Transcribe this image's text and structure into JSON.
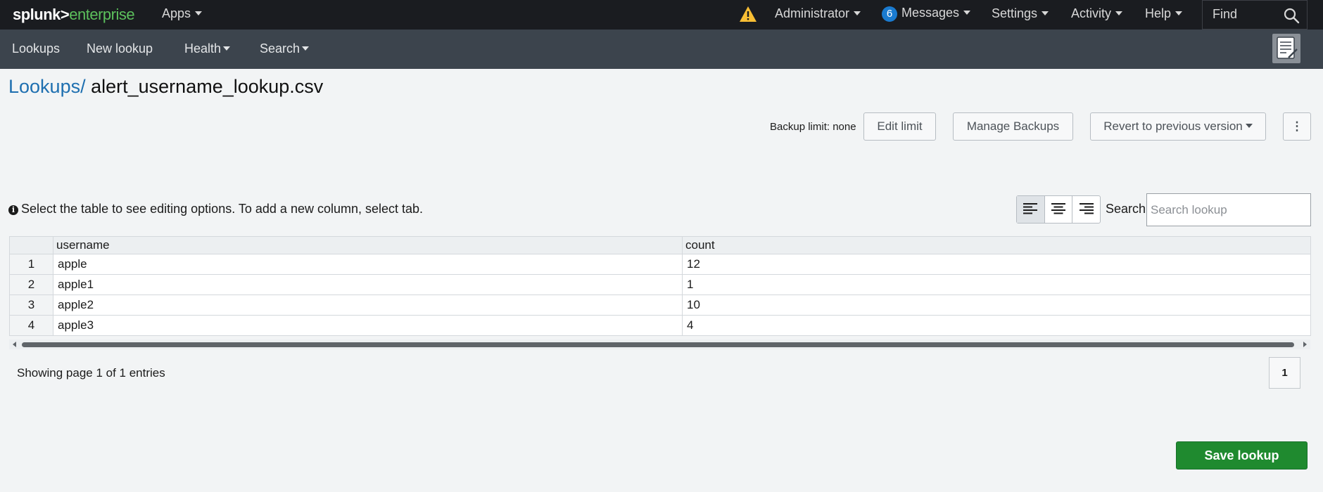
{
  "topbar": {
    "logo_primary": "splunk>",
    "logo_secondary": "enterprise",
    "apps": "Apps",
    "user": "Administrator",
    "messages_count": "6",
    "messages": "Messages",
    "settings": "Settings",
    "activity": "Activity",
    "help": "Help",
    "find": "Find"
  },
  "appbar": {
    "items": [
      "Lookups",
      "New lookup",
      "Health",
      "Search"
    ]
  },
  "page": {
    "breadcrumb": "Lookups/",
    "title": "alert_username_lookup.csv"
  },
  "backup": {
    "limit_label": "Backup limit: none",
    "edit_limit": "Edit limit",
    "manage_backups": "Manage Backups",
    "revert": "Revert to previous version",
    "more": "⋮"
  },
  "info": {
    "text": "Select the table to see editing options. To add a new column, select tab.",
    "search_label": "Search:",
    "search_placeholder": "Search lookup"
  },
  "table": {
    "columns": [
      "username",
      "count"
    ],
    "rows": [
      [
        "1",
        "apple",
        "12"
      ],
      [
        "2",
        "apple1",
        "1"
      ],
      [
        "3",
        "apple2",
        "10"
      ],
      [
        "4",
        "apple3",
        "4"
      ]
    ]
  },
  "pagination": {
    "showing": "Showing page 1 of 1 entries",
    "page": "1"
  },
  "actions": {
    "save": "Save lookup"
  },
  "colors": {
    "topbar_bg": "#1a1c20",
    "appbar_bg": "#3c444d",
    "link": "#1e6fb0",
    "primary_button": "#1f8a2f",
    "warning": "#f8be34",
    "badge": "#1a7bd0"
  }
}
